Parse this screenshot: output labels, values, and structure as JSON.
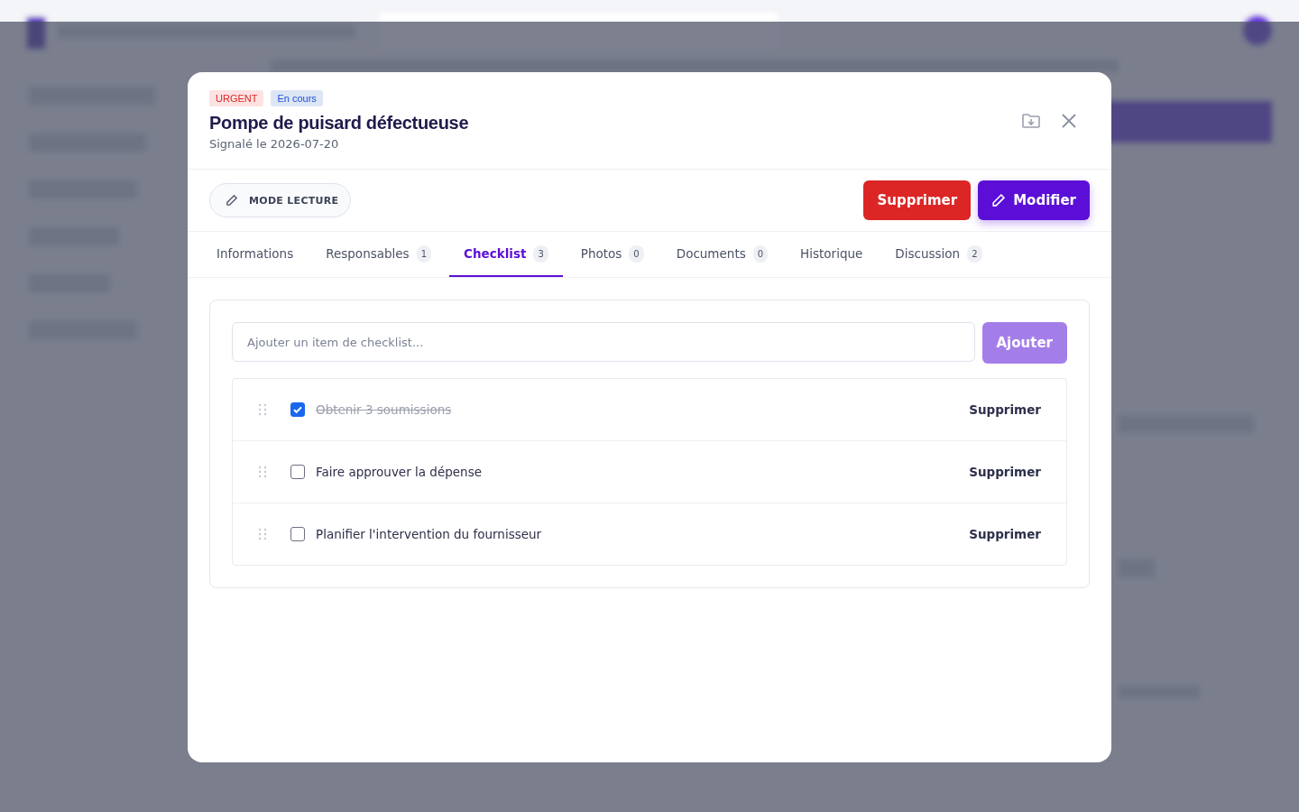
{
  "modal": {
    "tags": [
      {
        "label": "URGENT",
        "kind": "urgent"
      },
      {
        "label": "En cours",
        "kind": "status"
      }
    ],
    "title": "Pompe de puisard défectueuse",
    "subtitle": "Signalé le 2026-07-20",
    "mode_button": "MODE LECTURE",
    "delete_button": "Supprimer",
    "edit_button": "Modifier",
    "tabs": [
      {
        "label": "Informations",
        "selected": false
      },
      {
        "label": "Responsables",
        "count": "1",
        "selected": false
      },
      {
        "label": "Checklist",
        "count": "3",
        "selected": true
      },
      {
        "label": "Photos",
        "count": "0",
        "selected": false
      },
      {
        "label": "Documents",
        "count": "0",
        "selected": false
      },
      {
        "label": "Historique",
        "selected": false
      },
      {
        "label": "Discussion",
        "count": "2",
        "selected": false
      }
    ],
    "checklist": {
      "input": {
        "placeholder": "Ajouter un item de checklist..."
      },
      "add_button": "Ajouter",
      "items": [
        {
          "label": "Obtenir 3 soumissions",
          "checked": true,
          "action": "Supprimer"
        },
        {
          "label": "Faire approuver la dépense",
          "checked": false,
          "action": "Supprimer"
        },
        {
          "label": "Planifier l'intervention du fournisseur",
          "checked": false,
          "action": "Supprimer"
        }
      ]
    }
  }
}
